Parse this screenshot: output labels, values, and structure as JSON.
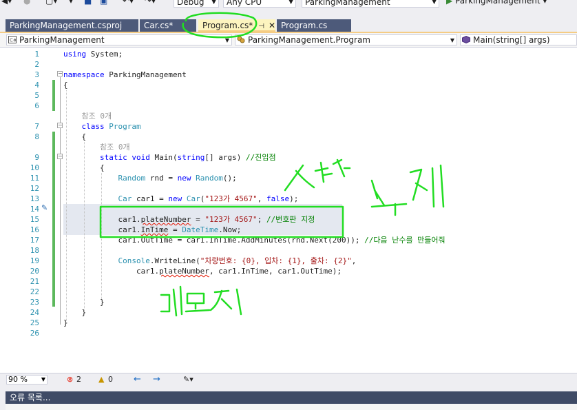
{
  "toolbar": {
    "config_label": "Debug",
    "platform_label": "Any CPU",
    "startup_project": "ParkingManagement",
    "run_target": "ParkingManagement"
  },
  "tabs": [
    {
      "label": "ParkingManagement.csproj",
      "state": "inactive"
    },
    {
      "label": "Car.cs*",
      "state": "inactive"
    },
    {
      "label": "Program.cs*",
      "state": "active",
      "pin": "⊣",
      "close": "✕"
    },
    {
      "label": "Program.cs",
      "state": "inactive"
    }
  ],
  "navbar": {
    "project": "ParkingManagement",
    "class": "ParkingManagement.Program",
    "member": "Main(string[] args)"
  },
  "code_lines": [
    {
      "n": "1",
      "html": "<span class='kw'>using</span> System;"
    },
    {
      "n": "2",
      "html": ""
    },
    {
      "n": "3",
      "html": "<span class='kw'>namespace</span> ParkingManagement"
    },
    {
      "n": "4",
      "html": "{"
    },
    {
      "n": "5",
      "html": ""
    },
    {
      "n": "6",
      "html": ""
    },
    {
      "n": "",
      "html": "    <span class='ref'>참조 0개</span>"
    },
    {
      "n": "7",
      "html": "    <span class='kw'>class</span> <span class='ty'>Program</span>"
    },
    {
      "n": "8",
      "html": "    {"
    },
    {
      "n": "",
      "html": "        <span class='ref'>참조 0개</span>"
    },
    {
      "n": "9",
      "html": "        <span class='kw'>static</span> <span class='kw'>void</span> Main(<span class='kw'>string</span>[] args) <span class='cm'>//진입점</span>"
    },
    {
      "n": "10",
      "html": "        {"
    },
    {
      "n": "11",
      "html": "            <span class='ty'>Random</span> rnd = <span class='kw'>new</span> <span class='ty'>Random</span>();"
    },
    {
      "n": "12",
      "html": ""
    },
    {
      "n": "13",
      "html": "            <span class='ty'>Car</span> car1 = <span class='kw'>new</span> <span class='ty'>Car</span>(<span class='str'>\"123가 4567\"</span>, <span class='kw'>false</span>);"
    },
    {
      "n": "14",
      "html": ""
    },
    {
      "n": "15",
      "html": "            car1.<span class='sq'>plateNumber</span> = <span class='str'>\"123가 4567\"</span>; <span class='cm'>//번호판 지정</span>"
    },
    {
      "n": "16",
      "html": "            car1.<span class='sq'>InTime</span> = <span class='ty'>DateTime</span>.Now;"
    },
    {
      "n": "17",
      "html": "            car1.OutTime = car1.InTime.AddMinutes(rnd.Next(200)); <span class='cm'>//다음 난수를 만들어줘</span>"
    },
    {
      "n": "18",
      "html": ""
    },
    {
      "n": "19",
      "html": "            <span class='ty'>Console</span>.WriteLine(<span class='str'>\"차량번호: {0}, 입차: {1}, 출차: {2}\"</span>,"
    },
    {
      "n": "20",
      "html": "                car1.<span class='sq'>plateNumber</span>, car1.InTime, car1.OutTime);"
    },
    {
      "n": "21",
      "html": ""
    },
    {
      "n": "22",
      "html": ""
    },
    {
      "n": "23",
      "html": "        }"
    },
    {
      "n": "24",
      "html": "    }"
    },
    {
      "n": "25",
      "html": "}"
    },
    {
      "n": "26",
      "html": ""
    }
  ],
  "status": {
    "zoom": "90 %",
    "errors": "2",
    "warnings": "0"
  },
  "error_list": {
    "title": "오류 목록..."
  },
  "colors": {
    "annotation": "#22dd22",
    "change_bar": "#5cb85c",
    "active_tab": "#fdf4bf"
  }
}
